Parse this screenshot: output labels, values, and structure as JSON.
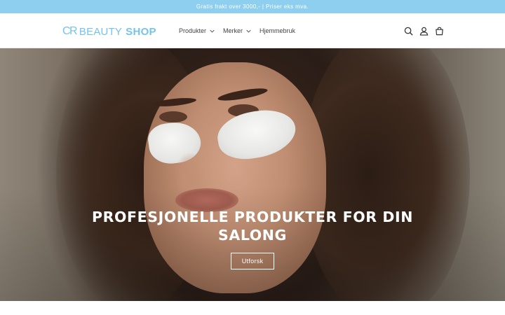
{
  "announcement": {
    "text": "Gratis frakt over 3000,-  |  Priser eks mva."
  },
  "header": {
    "logo": {
      "mark": "CR",
      "word1": "BEAUTY",
      "word2": "SHOP",
      "color": "#76c3ea"
    },
    "nav": [
      {
        "label": "Produkter",
        "has_dropdown": true,
        "icon": "chevron-down-icon"
      },
      {
        "label": "Merker",
        "has_dropdown": true,
        "icon": "chevron-down-icon"
      },
      {
        "label": "Hjemmebruk",
        "has_dropdown": false
      }
    ],
    "icons": [
      "search-icon",
      "account-icon",
      "cart-icon"
    ]
  },
  "hero": {
    "title": "PROFESJONELLE PRODUKTER FOR DIN SALONG",
    "button_label": "Utforsk"
  },
  "colors": {
    "announcement_bg": "#8ecff0",
    "announcement_text": "#ffffff",
    "brand": "#76c3ea"
  }
}
